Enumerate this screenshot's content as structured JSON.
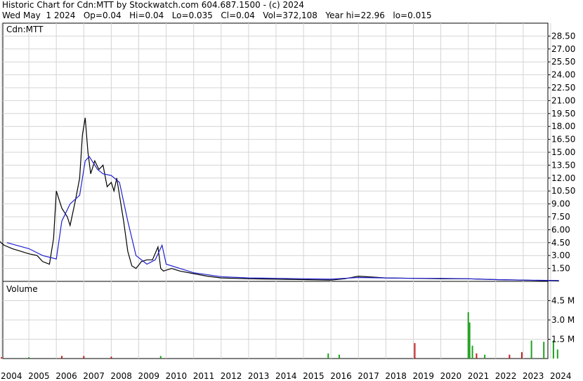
{
  "header": {
    "line1": "Historic Chart for Cdn:MTT by Stockwatch.com 604.687.1500 - (c) 2024",
    "line2": "Wed May  1 2024   Op=0.04   Hi=0.04   Lo=0.035   Cl=0.04   Vol=372,108   Year hi=22.96   lo=0.015"
  },
  "chart_data": [
    {
      "type": "line",
      "title": "Cdn:MTT",
      "ylabel": "",
      "xlabel": "",
      "ylim": [
        0,
        30
      ],
      "y_ticks": [
        "1.50",
        "3.00",
        "4.50",
        "6.00",
        "7.50",
        "9.00",
        "10.50",
        "12.00",
        "13.50",
        "15.00",
        "16.50",
        "18.00",
        "19.50",
        "21.00",
        "22.50",
        "24.00",
        "25.50",
        "27.00",
        "28.50"
      ],
      "x_ticks": [
        "2004",
        "2005",
        "2006",
        "2007",
        "2008",
        "2009",
        "2010",
        "2011",
        "2012",
        "2013",
        "2014",
        "2015",
        "2016",
        "2017",
        "2018",
        "2019",
        "2020",
        "2021",
        "2022",
        "2023",
        "2024"
      ],
      "grid": true,
      "colors": {
        "price": "#000000",
        "ma_short": "#d02020",
        "ma_mid": "#c030c0",
        "ma_long": "#2020d0"
      },
      "series": [
        {
          "x": [
            2003.8,
            2004.1,
            2004.4,
            2004.7,
            2005.0,
            2005.3,
            2005.5,
            2005.75,
            2005.9,
            2006.0,
            2006.2,
            2006.4,
            2006.5,
            2006.7,
            2006.85,
            2006.95,
            2007.05,
            2007.15,
            2007.25,
            2007.4,
            2007.55,
            2007.7,
            2007.85,
            2008.0,
            2008.1,
            2008.2,
            2008.3,
            2008.45,
            2008.6,
            2008.75,
            2008.9,
            2009.1,
            2009.3,
            2009.5,
            2009.7,
            2009.8,
            2009.9,
            2010.0,
            2010.2,
            2010.5,
            2011.0,
            2011.5,
            2012.0,
            2013.0,
            2014.0,
            2015.0,
            2016.0,
            2016.5,
            2017.0,
            2017.5,
            2018.0,
            2019.0,
            2020.0,
            2021.0,
            2022.0,
            2023.0,
            2024.3
          ],
          "values": [
            5.0,
            4.2,
            3.8,
            3.5,
            3.2,
            3.0,
            2.3,
            2.0,
            5.0,
            10.5,
            8.5,
            7.5,
            6.5,
            9.5,
            12.0,
            17.0,
            19.0,
            15.0,
            12.5,
            14.0,
            13.0,
            13.5,
            11.0,
            11.5,
            10.5,
            12.0,
            10.0,
            7.0,
            3.5,
            1.8,
            1.5,
            2.3,
            2.5,
            2.5,
            4.0,
            1.5,
            1.2,
            1.3,
            1.5,
            1.2,
            0.9,
            0.6,
            0.4,
            0.3,
            0.25,
            0.2,
            0.15,
            0.3,
            0.6,
            0.5,
            0.4,
            0.35,
            0.3,
            0.3,
            0.2,
            0.15,
            0.04
          ]
        },
        {
          "x": [
            2004.2,
            2005.0,
            2005.5,
            2006.0,
            2006.2,
            2006.5,
            2006.85,
            2007.05,
            2007.2,
            2007.5,
            2007.7,
            2008.0,
            2008.3,
            2008.6,
            2008.9,
            2009.3,
            2009.6,
            2009.85,
            2010.0,
            2010.5,
            2011.0,
            2012.0,
            2013.0,
            2014.0,
            2015.0,
            2016.0,
            2017.0,
            2018.0,
            2019.0,
            2020.0,
            2021.0,
            2022.0,
            2023.0,
            2024.3
          ],
          "values": [
            4.5,
            3.8,
            3.0,
            2.6,
            7.0,
            9.0,
            10.0,
            14.0,
            14.5,
            13.0,
            12.5,
            12.3,
            11.5,
            7.0,
            3.0,
            2.0,
            2.5,
            4.2,
            2.0,
            1.5,
            1.0,
            0.55,
            0.4,
            0.35,
            0.3,
            0.25,
            0.45,
            0.4,
            0.35,
            0.35,
            0.3,
            0.2,
            0.15,
            0.1
          ]
        }
      ]
    },
    {
      "type": "bar",
      "title": "Volume",
      "ylim": [
        0,
        6.0
      ],
      "y_ticks": [
        "1.5 M",
        "3.0 M",
        "4.5 M"
      ],
      "colors": {
        "up": "#20a020",
        "down": "#c02020"
      },
      "bars": [
        {
          "x": 2004.0,
          "values": 0.1,
          "up": false
        },
        {
          "x": 2005.0,
          "values": 0.1,
          "up": true
        },
        {
          "x": 2006.2,
          "values": 0.2,
          "up": false
        },
        {
          "x": 2007.0,
          "values": 0.2,
          "up": false
        },
        {
          "x": 2008.0,
          "values": 0.15,
          "up": false
        },
        {
          "x": 2009.8,
          "values": 0.2,
          "up": true
        },
        {
          "x": 2015.9,
          "values": 0.4,
          "up": true
        },
        {
          "x": 2016.3,
          "values": 0.3,
          "up": true
        },
        {
          "x": 2019.05,
          "values": 1.2,
          "up": false
        },
        {
          "x": 2021.0,
          "values": 3.6,
          "up": true
        },
        {
          "x": 2021.05,
          "values": 2.8,
          "up": true
        },
        {
          "x": 2021.15,
          "values": 1.0,
          "up": true
        },
        {
          "x": 2021.3,
          "values": 0.4,
          "up": false
        },
        {
          "x": 2021.6,
          "values": 0.3,
          "up": true
        },
        {
          "x": 2022.5,
          "values": 0.3,
          "up": false
        },
        {
          "x": 2022.95,
          "values": 0.5,
          "up": false
        },
        {
          "x": 2023.3,
          "values": 1.4,
          "up": true
        },
        {
          "x": 2023.75,
          "values": 1.3,
          "up": true
        },
        {
          "x": 2024.1,
          "values": 1.4,
          "up": true
        },
        {
          "x": 2024.25,
          "values": 0.7,
          "up": true
        }
      ]
    }
  ]
}
